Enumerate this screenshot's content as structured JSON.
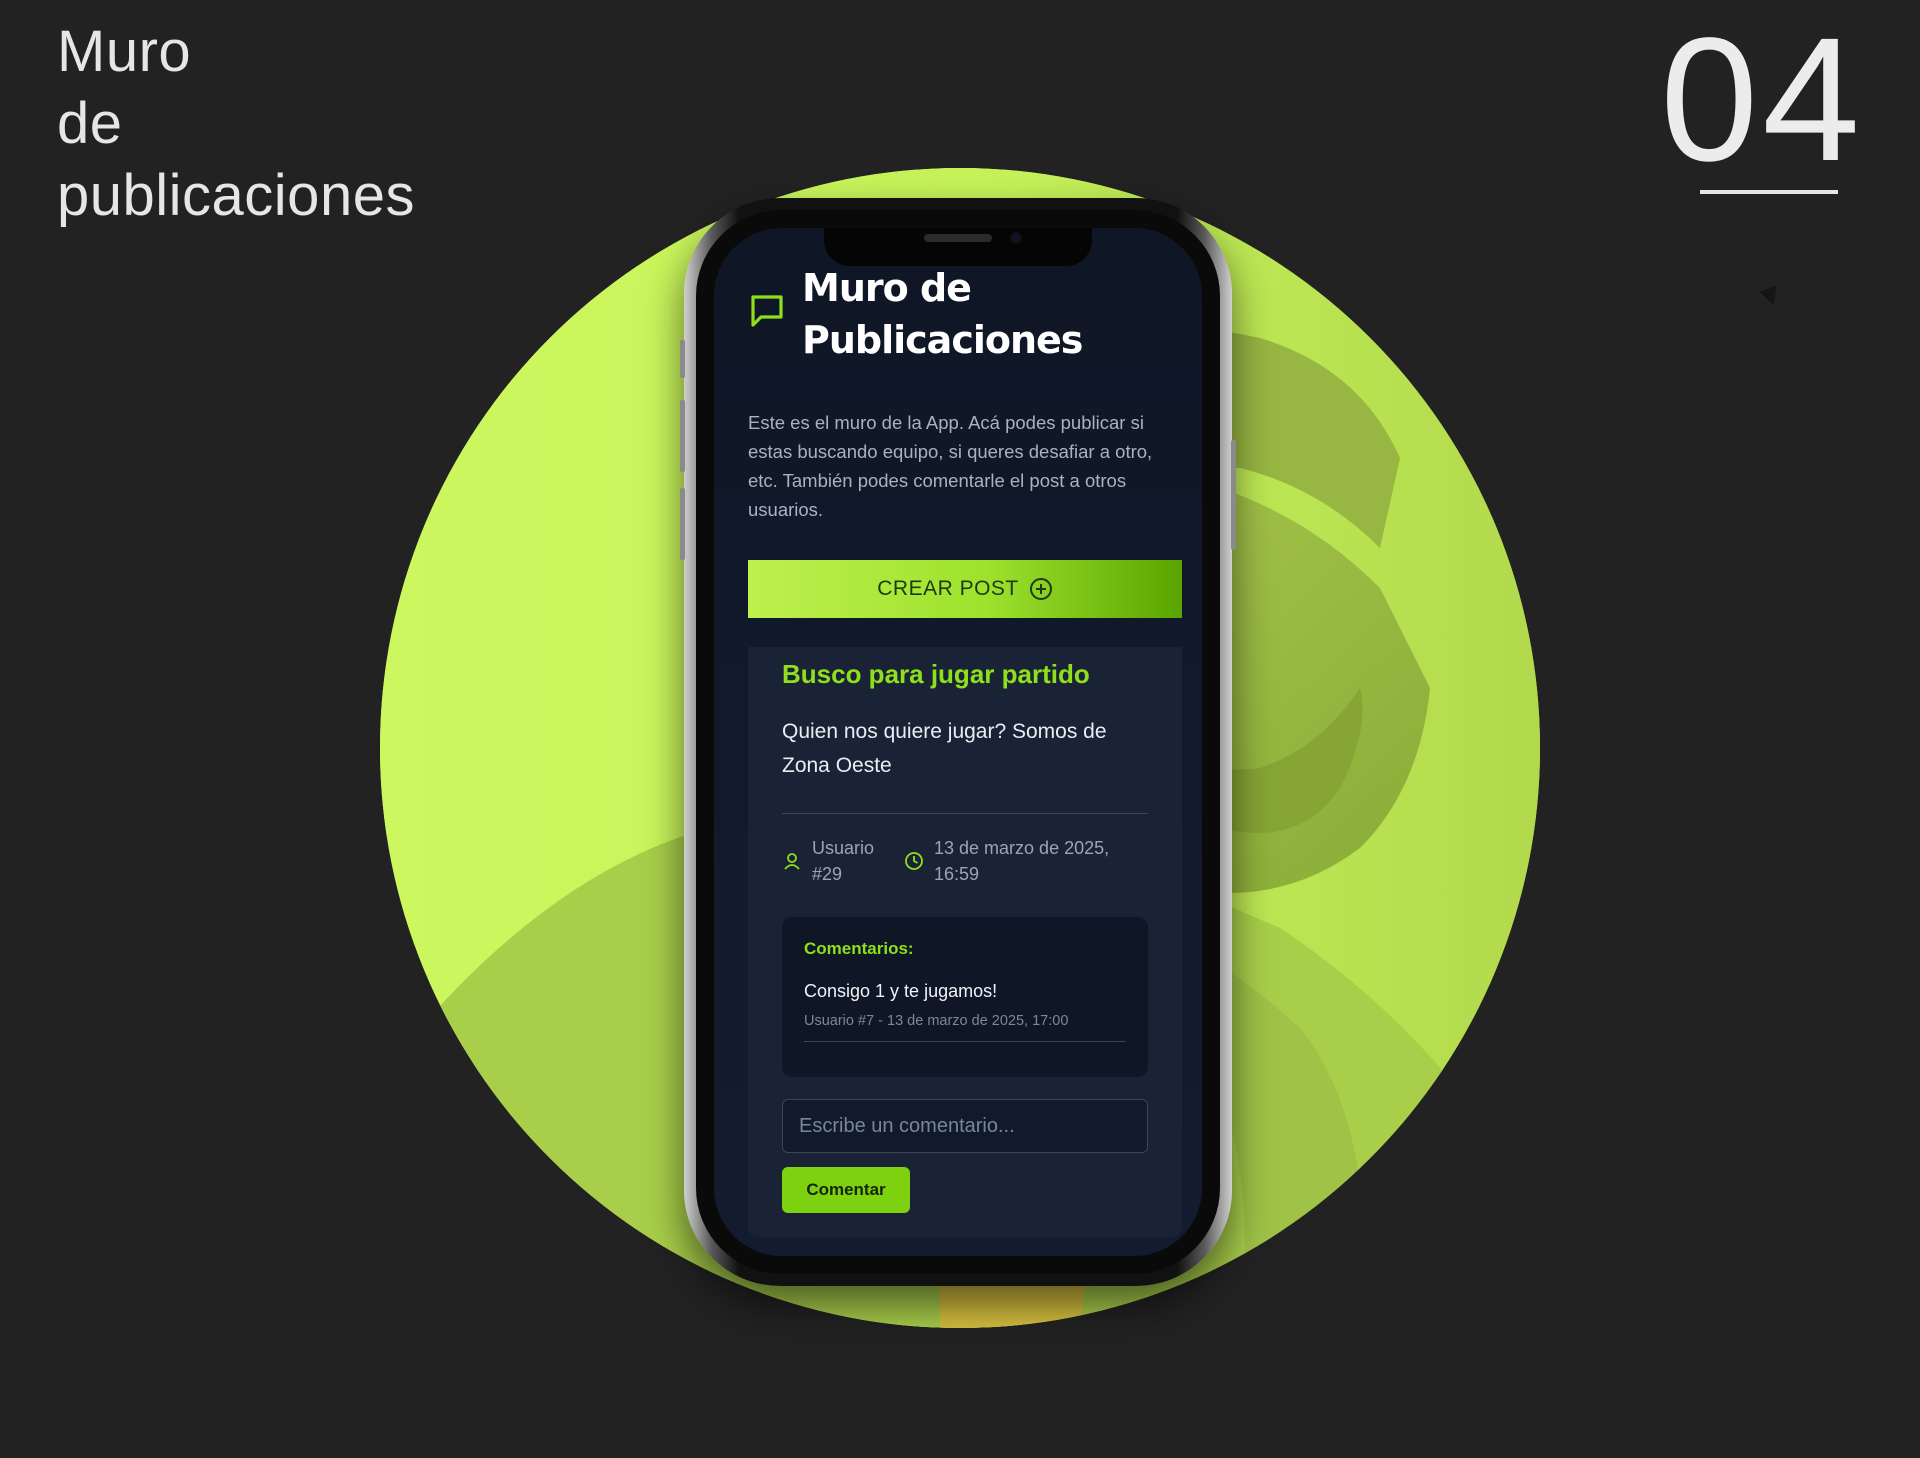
{
  "heading": {
    "line1": "Muro",
    "line2": "de",
    "line3": "publicaciones"
  },
  "section_number": "04",
  "colors": {
    "accent": "#8fe01c",
    "circle": "#c8f55c",
    "background": "#222222",
    "screen": "#111a2b"
  },
  "app": {
    "title": "Muro de Publicaciones",
    "intro": "Este es el muro de la App. Acá podes publicar si estas buscando equipo, si queres desafiar a otro, etc. También podes comentarle el post a otros usuarios.",
    "create_button": "CREAR POST",
    "icons": {
      "title": "chat-bubble-icon",
      "create": "plus-circle-icon",
      "user": "user-icon",
      "time": "clock-icon"
    }
  },
  "post": {
    "title": "Busco para jugar partido",
    "body": "Quien nos quiere jugar? Somos de Zona Oeste",
    "user": "Usuario #29",
    "date": "13 de marzo de 2025, 16:59",
    "comments_label": "Comentarios:",
    "comments": [
      {
        "text": "Consigo 1 y te jugamos!",
        "meta": "Usuario #7 - 13 de marzo de 2025, 17:00"
      }
    ],
    "comment_input": {
      "value": "",
      "placeholder": "Escribe un comentario..."
    },
    "comment_button": "Comentar"
  }
}
